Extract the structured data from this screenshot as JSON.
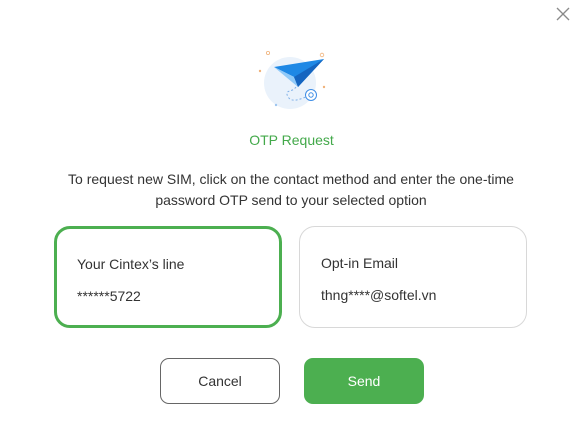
{
  "dialog": {
    "title": "OTP Request",
    "description": "To request new SIM, click on the contact method and enter the one-time password OTP send to your selected option",
    "options": [
      {
        "label": "Your Cintex’s line",
        "value": "******5722",
        "selected": true
      },
      {
        "label": "Opt-in Email",
        "value": "thng****@softel.vn",
        "selected": false
      }
    ],
    "cancel_label": "Cancel",
    "send_label": "Send"
  },
  "icons": {
    "close": "close-icon",
    "illustration": "paper-plane-icon"
  },
  "colors": {
    "accent": "#4caf50",
    "title": "#43a94a",
    "plane_dark": "#1e88e5",
    "plane_light": "#90caf9",
    "illustration_bg": "#eaf2fb",
    "border": "#d8d8d8"
  }
}
